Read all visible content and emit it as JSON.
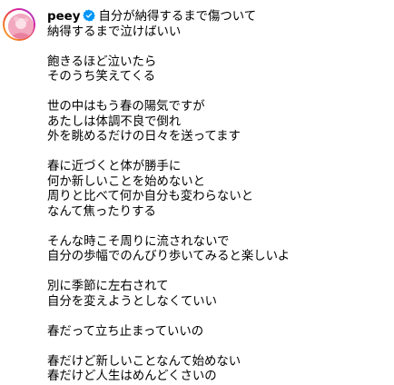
{
  "post": {
    "username": "peey",
    "avatar_icon": "pink-profile-avatar",
    "verified_icon": "verified-badge-icon",
    "verified_color": "#0095f6",
    "caption_lines": [
      "自分が納得するまで傷ついて",
      "納得するまで泣けばいい",
      "",
      "飽きるほど泣いたら",
      "そのうち笑えてくる",
      "",
      "世の中はもう春の陽気ですが",
      "あたしは体調不良で倒れ",
      "外を眺めるだけの日々を送ってます",
      "",
      "春に近づくと体が勝手に",
      "何か新しいことを始めないと",
      "周りと比べて何か自分も変わらないと",
      "なんて焦ったりする",
      "",
      "そんな時こそ周りに流されないで",
      "自分の歩幅でのんびり歩いてみると楽しいよ",
      "",
      "別に季節に左右されて",
      "自分を変えようとしなくていい",
      "",
      "春だって立ち止まっていいの",
      "",
      "春だけど新しいことなんて始めない",
      "春だけど人生はめんどくさいの"
    ]
  }
}
